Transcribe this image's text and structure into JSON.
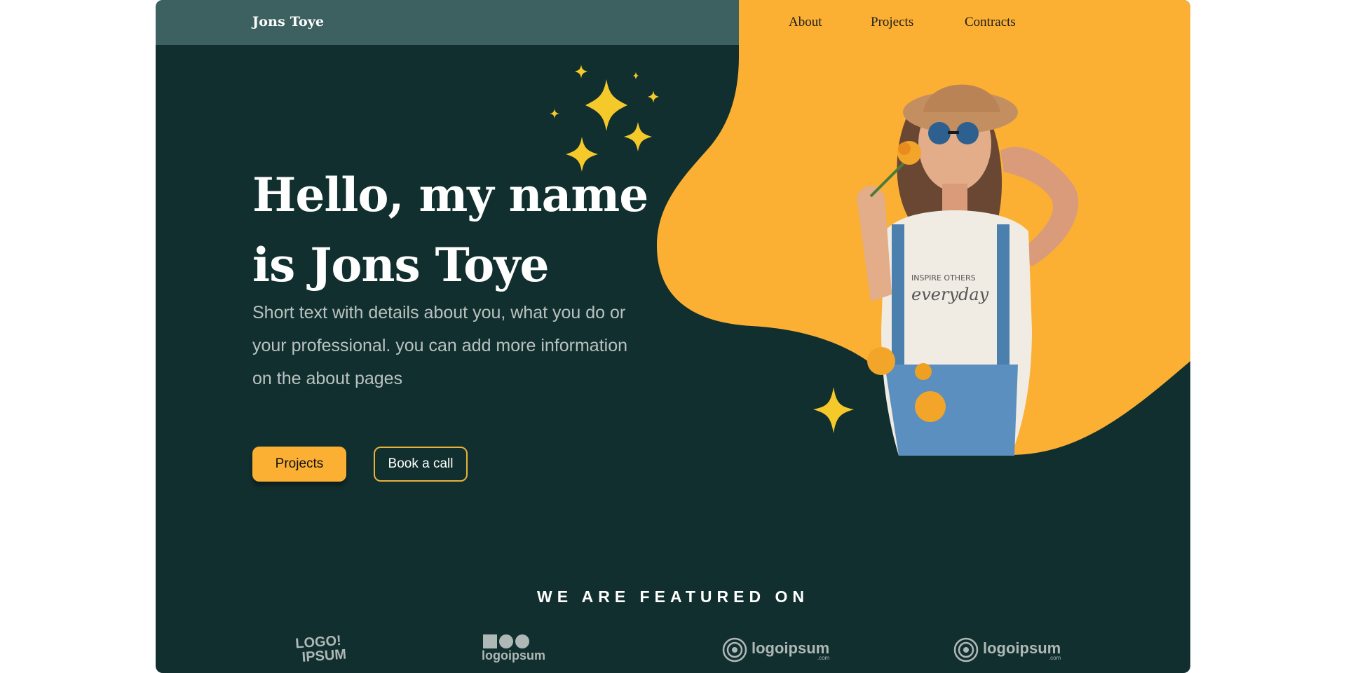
{
  "header": {
    "brand": "Jons Toye",
    "nav": [
      {
        "label": "About"
      },
      {
        "label": "Projects"
      },
      {
        "label": "Contracts"
      }
    ]
  },
  "hero": {
    "title_line1": "Hello, my name",
    "title_line2": "is Jons Toye",
    "subtitle": "Short text with details about you, what you do or your professional. you can add more information on the about pages",
    "primary_button": "Projects",
    "secondary_button": "Book a call",
    "photo_shirt_text_1": "INSPIRE OTHERS",
    "photo_shirt_text_2": "everyday"
  },
  "featured": {
    "label": "WE ARE FEATURED ON",
    "logos": [
      {
        "line1": "LOGO!",
        "line2": "IPSUM"
      },
      {
        "text": "logoipsum"
      },
      {
        "text": "logoipsum",
        "sub": ".com"
      },
      {
        "text": "logoipsum",
        "sub": ".com"
      }
    ]
  },
  "colors": {
    "background": "#112f2e",
    "header": "#3c6160",
    "accent": "#fbb034",
    "star": "#f6c92a",
    "muted_text": "#b9c2c1"
  },
  "icons": [
    "sparkle-icon",
    "logo-icon"
  ]
}
